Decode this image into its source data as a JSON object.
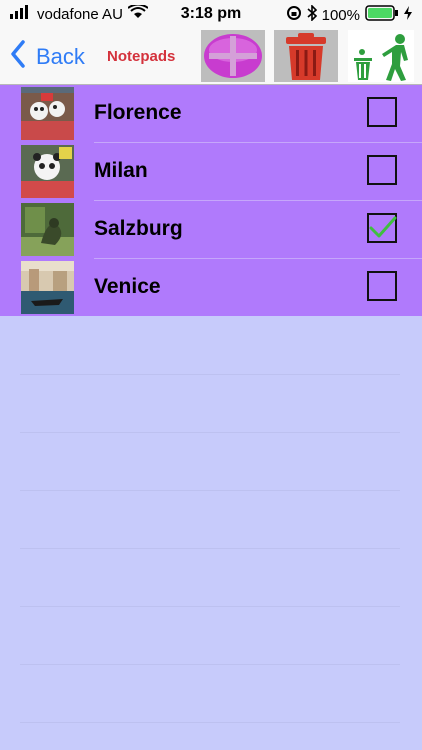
{
  "status_bar": {
    "carrier": "vodafone AU",
    "time": "3:18 pm",
    "battery": "100%",
    "icons": [
      "signal-bars-icon",
      "wifi-icon",
      "rotation-lock-icon",
      "bluetooth-icon",
      "battery-icon",
      "charging-bolt-icon"
    ]
  },
  "nav": {
    "back_label": "Back",
    "title": "Notepads",
    "buttons": [
      "add-icon",
      "trash-icon",
      "recycle-person-icon"
    ]
  },
  "notepads": [
    {
      "label": "Florence",
      "checked": false
    },
    {
      "label": "Milan",
      "checked": false
    },
    {
      "label": "Salzburg",
      "checked": true
    },
    {
      "label": "Venice",
      "checked": false
    }
  ],
  "colors": {
    "list_bg": "#b07afc",
    "page_bg": "#c7cbfb",
    "title_red": "#d4323c",
    "back_blue": "#2f7cf6",
    "check_green": "#3fbf3f"
  }
}
